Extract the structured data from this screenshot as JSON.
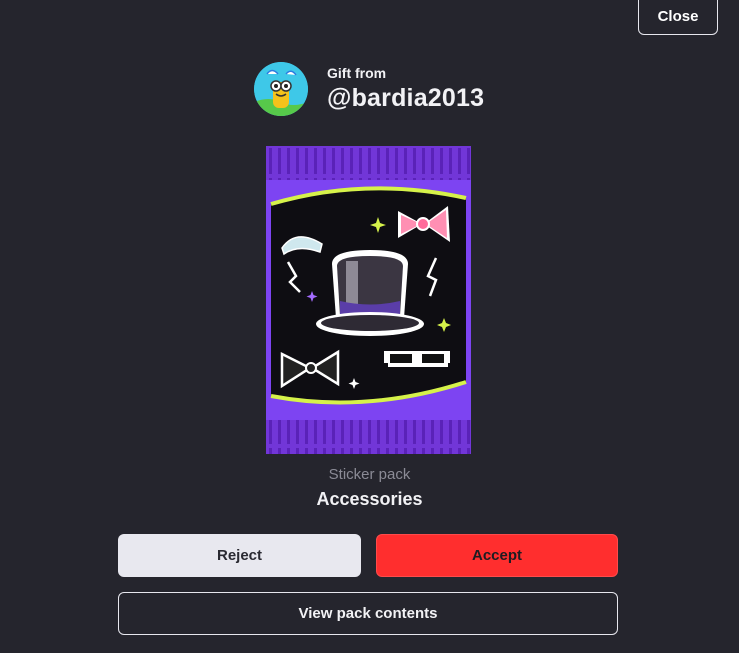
{
  "close_label": "Close",
  "gift": {
    "from_label": "Gift from",
    "username": "@bardia2013"
  },
  "pack": {
    "type_label": "Sticker pack",
    "name": "Accessories"
  },
  "actions": {
    "reject_label": "Reject",
    "accept_label": "Accept",
    "view_label": "View pack contents"
  },
  "colors": {
    "background": "#25252d",
    "accept": "#ff2e2e",
    "reject": "#e8e8ef",
    "pack_purple": "#7a3df0"
  },
  "icons": {
    "avatar": "cartoon-avatar-icon",
    "pack_art": "sticker-pack-icon"
  }
}
